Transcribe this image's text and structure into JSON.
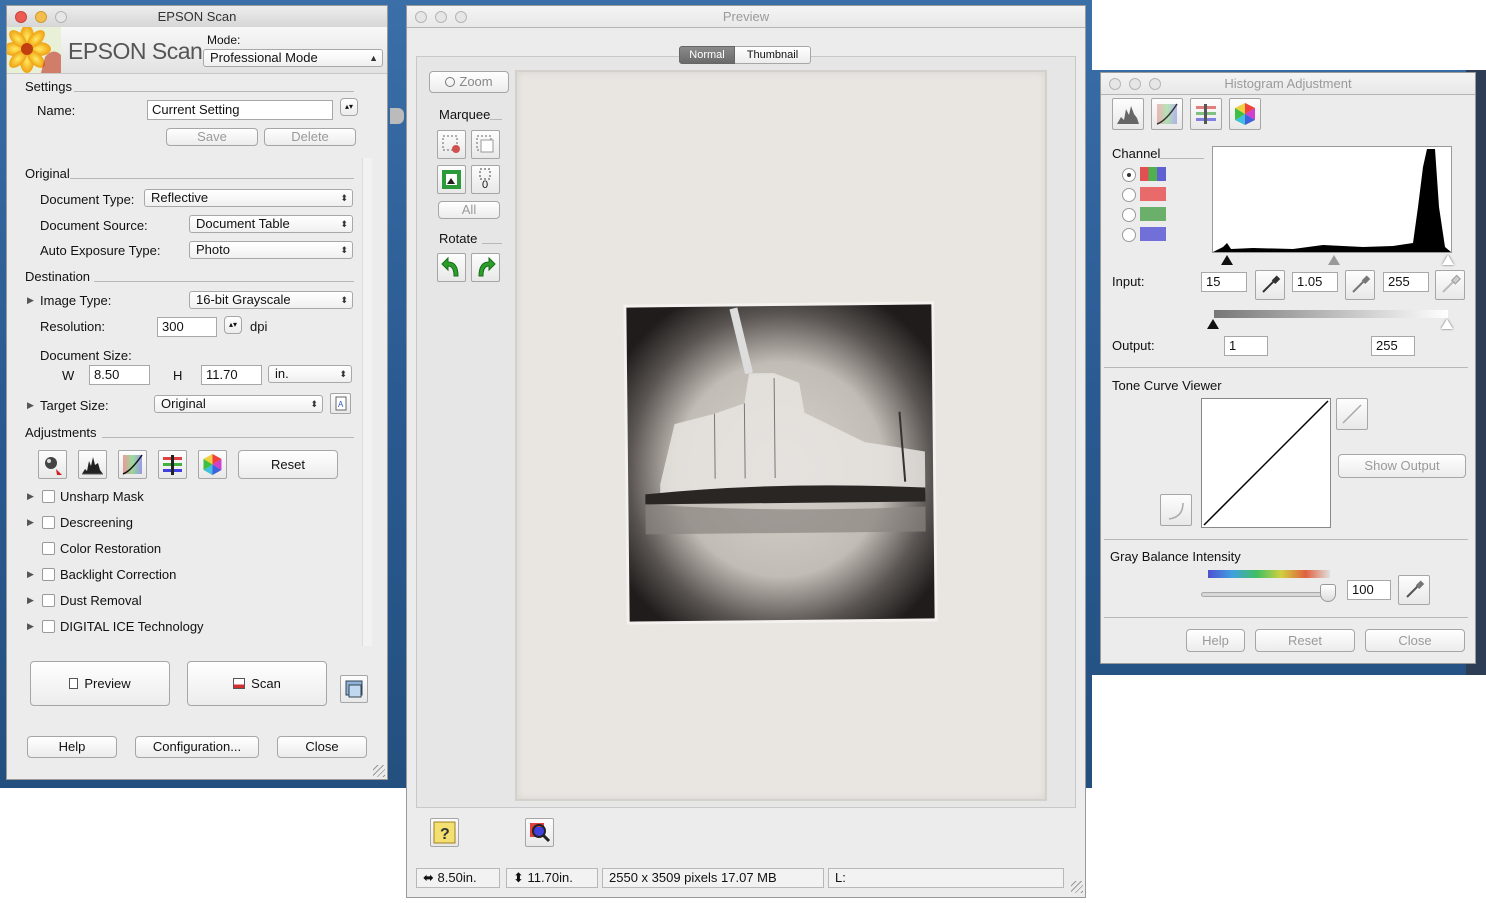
{
  "epson": {
    "title": "EPSON Scan",
    "logo_text": "EPSON Scan",
    "mode_label": "Mode:",
    "mode_value": "Professional Mode",
    "settings_label": "Settings",
    "name_label": "Name:",
    "name_value": "Current Setting",
    "save_label": "Save",
    "delete_label": "Delete",
    "original_label": "Original",
    "doc_type_label": "Document Type:",
    "doc_type_value": "Reflective",
    "doc_source_label": "Document Source:",
    "doc_source_value": "Document Table",
    "auto_exposure_label": "Auto Exposure Type:",
    "auto_exposure_value": "Photo",
    "destination_label": "Destination",
    "image_type_label": "Image Type:",
    "image_type_value": "16-bit Grayscale",
    "resolution_label": "Resolution:",
    "resolution_value": "300",
    "dpi_label": "dpi",
    "doc_size_label": "Document Size:",
    "w_label": "W",
    "w_value": "8.50",
    "h_label": "H",
    "h_value": "11.70",
    "unit_value": "in.",
    "target_size_label": "Target Size:",
    "target_size_value": "Original",
    "adjustments_label": "Adjustments",
    "reset_label": "Reset",
    "options": [
      {
        "label": "Unsharp Mask",
        "expandable": true
      },
      {
        "label": "Descreening",
        "expandable": true
      },
      {
        "label": "Color Restoration",
        "expandable": false
      },
      {
        "label": "Backlight Correction",
        "expandable": true
      },
      {
        "label": "Dust Removal",
        "expandable": true
      },
      {
        "label": "DIGITAL ICE Technology",
        "expandable": true
      }
    ],
    "preview_label": "Preview",
    "scan_label": "Scan",
    "help_label": "Help",
    "config_label": "Configuration...",
    "close_label": "Close"
  },
  "preview": {
    "title": "Preview",
    "tab_normal": "Normal",
    "tab_thumbnail": "Thumbnail",
    "zoom_label": "Zoom",
    "marquee_label": "Marquee",
    "marquee_count": "0",
    "all_label": "All",
    "rotate_label": "Rotate",
    "status_width": "8.50in.",
    "status_height": "11.70in.",
    "status_pixels": "2550 x 3509 pixels 17.07 MB",
    "status_l": "L:"
  },
  "histogram": {
    "title": "Histogram Adjustment",
    "channel_label": "Channel",
    "input_label": "Input:",
    "input_shadow": "15",
    "input_gamma": "1.05",
    "input_highlight": "255",
    "output_label": "Output:",
    "output_low": "1",
    "output_high": "255",
    "tone_curve_label": "Tone Curve Viewer",
    "show_output_label": "Show Output",
    "gray_balance_label": "Gray Balance Intensity",
    "gray_balance_value": "100",
    "help_label": "Help",
    "reset_label": "Reset",
    "close_label": "Close",
    "channel_colors": [
      "#5a9a5a",
      "#e86a6a",
      "#6ab06a",
      "#7070d8"
    ]
  }
}
